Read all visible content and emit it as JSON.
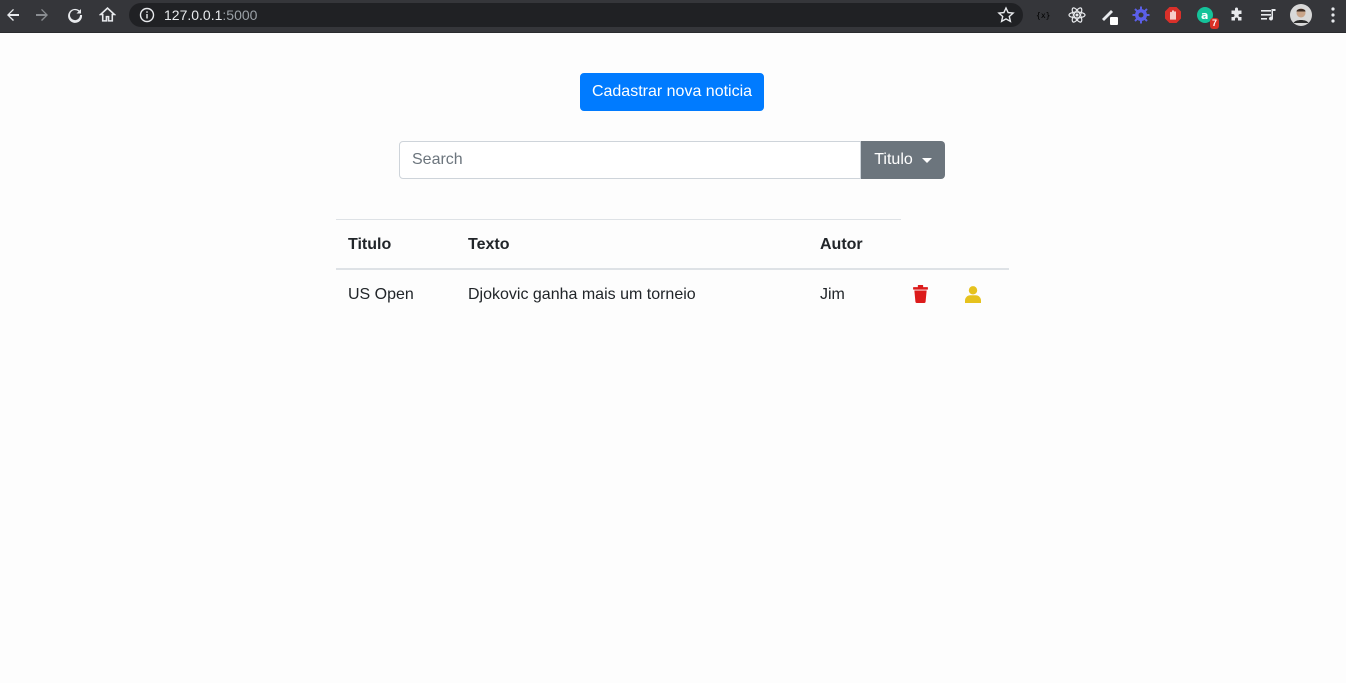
{
  "browser": {
    "url_host": "127.0.0.1",
    "url_port": ":5000",
    "extension_badge": "7"
  },
  "page": {
    "new_button_label": "Cadastrar nova noticia",
    "search_placeholder": "Search",
    "search_value": "",
    "filter_dropdown_label": "Titulo"
  },
  "table": {
    "headers": [
      "Titulo",
      "Texto",
      "Autor"
    ],
    "rows": [
      {
        "titulo": "US Open",
        "texto": "Djokovic ganha mais um torneio",
        "autor": "Jim"
      }
    ]
  },
  "colors": {
    "primary": "#007bff",
    "secondary": "#6c757d",
    "delete_icon": "#dc1b1b",
    "user_icon": "#e6c21e"
  }
}
